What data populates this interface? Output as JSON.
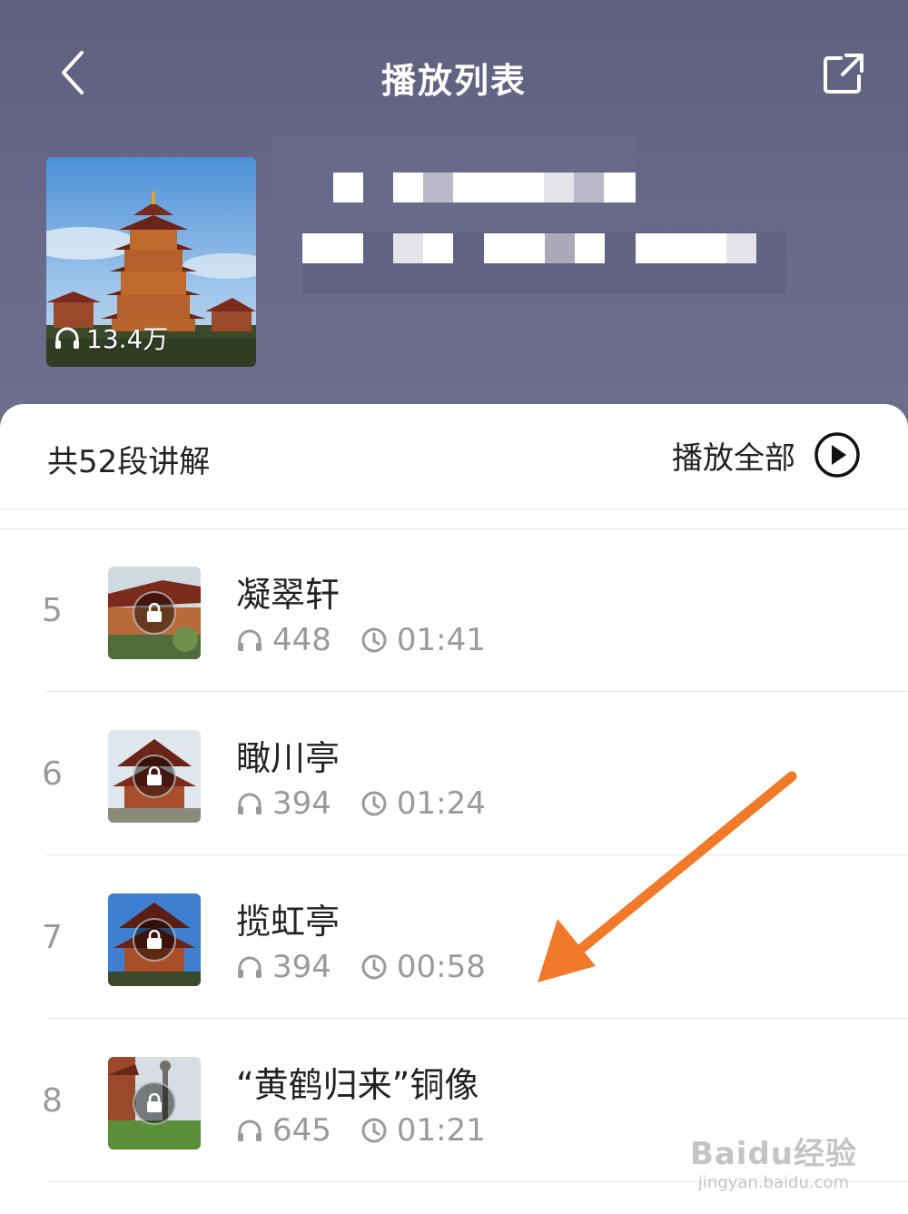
{
  "header": {
    "title": "播放列表",
    "back_icon": "chevron-left-icon",
    "share_icon": "share-external-icon"
  },
  "album": {
    "play_count": "13.4万",
    "title_redacted": true
  },
  "list": {
    "summary": "共52段讲解",
    "play_all_label": "播放全部",
    "items": [
      {
        "index": "5",
        "name": "凝翠轩",
        "plays": "448",
        "duration": "01:41",
        "locked": true
      },
      {
        "index": "6",
        "name": "瞰川亭",
        "plays": "394",
        "duration": "01:24",
        "locked": true
      },
      {
        "index": "7",
        "name": "揽虹亭",
        "plays": "394",
        "duration": "00:58",
        "locked": true
      },
      {
        "index": "8",
        "name": "“黄鹤归来”铜像",
        "plays": "645",
        "duration": "01:21",
        "locked": true
      }
    ]
  },
  "annotation": {
    "type": "arrow",
    "color": "#f07a2a"
  },
  "watermark": {
    "main": "Baidu经验",
    "sub": "jingyan.baidu.com"
  }
}
